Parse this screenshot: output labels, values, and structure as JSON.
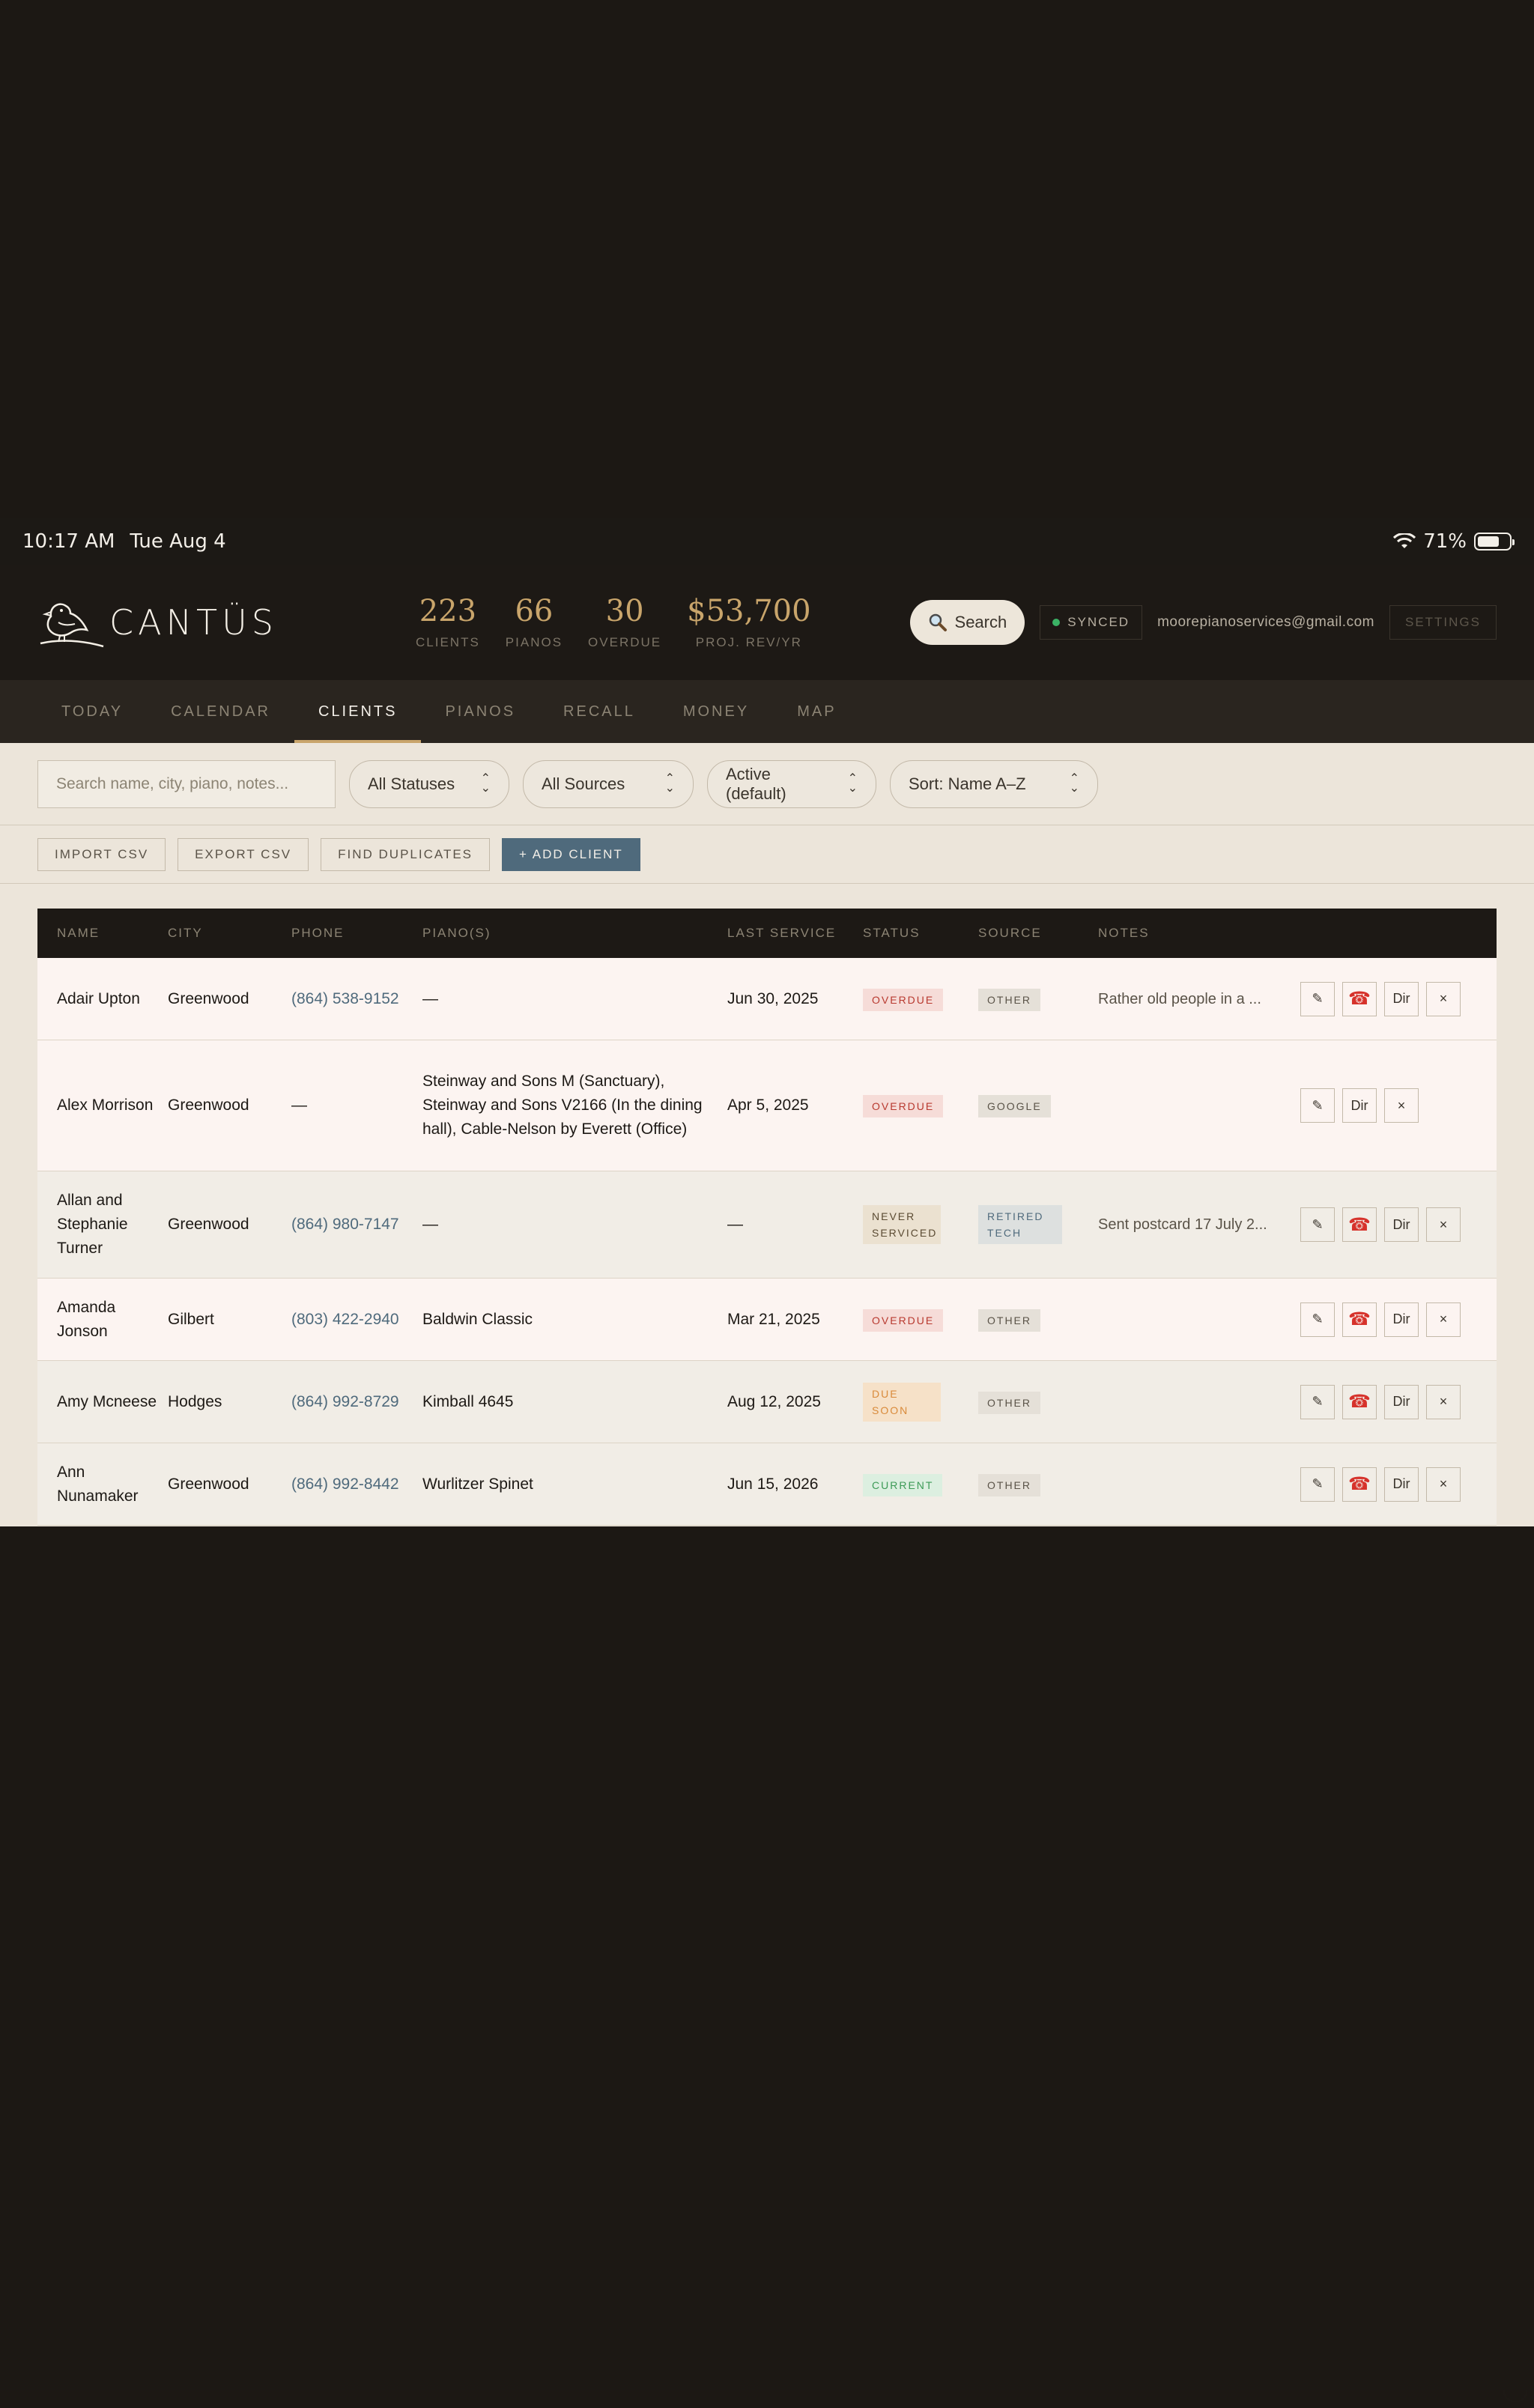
{
  "status_bar": {
    "time": "10:17 AM",
    "date": "Tue Aug 4",
    "battery": "71%",
    "battery_level": 0.71
  },
  "brand": {
    "name": "CANTÜS"
  },
  "stats": [
    {
      "value": "223",
      "label": "CLIENTS"
    },
    {
      "value": "66",
      "label": "PIANOS"
    },
    {
      "value": "30",
      "label": "OVERDUE"
    },
    {
      "value": "$53,700",
      "label": "PROJ. REV/YR"
    }
  ],
  "header": {
    "search_label": "Search",
    "synced_label": "SYNCED",
    "email": "moorepianoservices@gmail.com",
    "settings_label": "SETTINGS"
  },
  "nav": [
    {
      "label": "TODAY",
      "active": false
    },
    {
      "label": "CALENDAR",
      "active": false
    },
    {
      "label": "CLIENTS",
      "active": true
    },
    {
      "label": "PIANOS",
      "active": false
    },
    {
      "label": "RECALL",
      "active": false
    },
    {
      "label": "MONEY",
      "active": false
    },
    {
      "label": "MAP",
      "active": false
    }
  ],
  "filters": {
    "search_placeholder": "Search name, city, piano, notes...",
    "status": "All Statuses",
    "source": "All Sources",
    "active": "Active (default)",
    "sort": "Sort: Name A–Z"
  },
  "actions": {
    "import": "IMPORT CSV",
    "export": "EXPORT CSV",
    "duplicates": "FIND DUPLICATES",
    "add": "+ ADD CLIENT"
  },
  "table": {
    "headers": {
      "name": "NAME",
      "city": "CITY",
      "phone": "PHONE",
      "pianos": "PIANO(S)",
      "last_service": "LAST SERVICE",
      "status": "STATUS",
      "source": "SOURCE",
      "notes": "NOTES"
    },
    "rows": [
      {
        "name": "Adair Upton",
        "city": "Greenwood",
        "phone": "(864) 538-9152",
        "pianos": "—",
        "last_service": "Jun 30, 2025",
        "status": "OVERDUE",
        "status_type": "overdue",
        "source": "OTHER",
        "source_type": "source",
        "notes": "Rather old people in a ...",
        "has_phone": true,
        "bg": "pink"
      },
      {
        "name": "Alex Morrison",
        "city": "Greenwood",
        "phone": "—",
        "pianos": "Steinway and Sons M (Sanctuary), Steinway and Sons V2166 (In the dining hall), Cable-Nelson by Everett (Office)",
        "last_service": "Apr 5, 2025",
        "status": "OVERDUE",
        "status_type": "overdue",
        "source": "GOOGLE",
        "source_type": "source",
        "notes": "",
        "has_phone": false,
        "bg": "pink"
      },
      {
        "name": "Allan and Stephanie Turner",
        "city": "Greenwood",
        "phone": "(864) 980-7147",
        "pianos": "—",
        "last_service": "—",
        "status": "NEVER SERVICED",
        "status_type": "never",
        "source": "RETIRED TECH",
        "source_type": "retired",
        "notes": "Sent postcard 17 July 2...",
        "has_phone": true,
        "bg": "beige"
      },
      {
        "name": "Amanda Jonson",
        "city": "Gilbert",
        "phone": "(803) 422-2940",
        "pianos": "Baldwin Classic",
        "last_service": "Mar 21, 2025",
        "status": "OVERDUE",
        "status_type": "overdue",
        "source": "OTHER",
        "source_type": "source",
        "notes": "",
        "has_phone": true,
        "bg": "pink"
      },
      {
        "name": "Amy Mcneese",
        "city": "Hodges",
        "phone": "(864) 992-8729",
        "pianos": "Kimball 4645",
        "last_service": "Aug 12, 2025",
        "status": "DUE SOON",
        "status_type": "due",
        "source": "OTHER",
        "source_type": "source",
        "notes": "",
        "has_phone": true,
        "bg": "beige"
      },
      {
        "name": "Ann Nunamaker",
        "city": "Greenwood",
        "phone": "(864) 992-8442",
        "pianos": "Wurlitzer Spinet",
        "last_service": "Jun 15, 2026",
        "status": "CURRENT",
        "status_type": "current",
        "source": "OTHER",
        "source_type": "source",
        "notes": "",
        "has_phone": true,
        "bg": "beige"
      }
    ],
    "row_actions": {
      "edit": "✎",
      "phone": "☎",
      "dir": "Dir",
      "delete": "×"
    }
  }
}
